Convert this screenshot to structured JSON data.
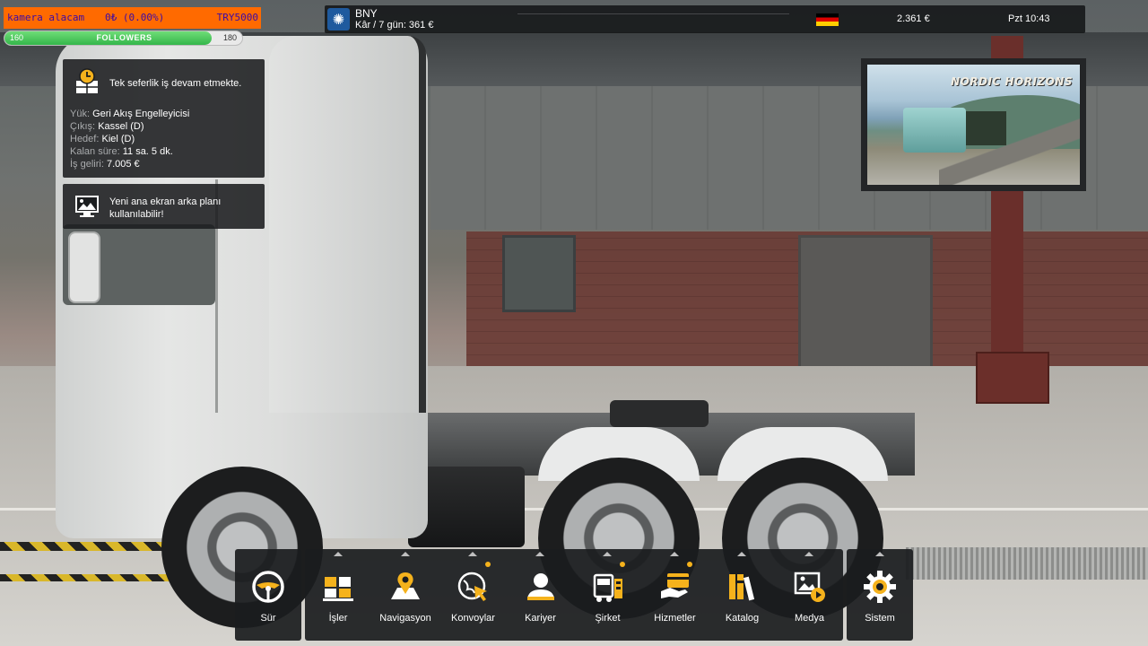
{
  "stream_overlay": {
    "title": "kamera alacam",
    "change": "0₺ (0.00%)",
    "goal": "TRY5000",
    "followers": {
      "start": "160",
      "label": "FOLLOWERS",
      "goal": "180",
      "progress_fraction": 0.87
    }
  },
  "topbar": {
    "company_name": "BNY",
    "company_profit": "Kâr / 7 gün: 361 €",
    "country_flag": "germany-flag",
    "money": "2.361 €",
    "clock": "Pzt 10:43"
  },
  "job_notification": {
    "title": "Tek seferlik iş devam etmekte.",
    "fields": [
      {
        "key": "Yük:",
        "value": "Geri Akış Engelleyicisi"
      },
      {
        "key": "Çıkış:",
        "value": "Kassel (D)"
      },
      {
        "key": "Hedef:",
        "value": "Kiel (D)"
      },
      {
        "key": "Kalan süre:",
        "value": "11 sa. 5 dk."
      },
      {
        "key": "İş geliri:",
        "value": "7.005 €"
      }
    ]
  },
  "background_notification": {
    "title": "Yeni ana ekran arka planı kullanılabilir!"
  },
  "featured_image": {
    "title": "NORDIC HORIZONS"
  },
  "menu": {
    "items": [
      {
        "label": "Sür",
        "icon": "steering-wheel-icon"
      },
      {
        "label": "İşler",
        "icon": "cargo-boxes-icon"
      },
      {
        "label": "Navigasyon",
        "icon": "map-pin-icon"
      },
      {
        "label": "Konvoylar",
        "icon": "convoy-globe-icon"
      },
      {
        "label": "Kariyer",
        "icon": "person-icon"
      },
      {
        "label": "Şirket",
        "icon": "company-truck-icon"
      },
      {
        "label": "Hizmetler",
        "icon": "services-card-icon"
      },
      {
        "label": "Katalog",
        "icon": "catalog-books-icon"
      },
      {
        "label": "Medya",
        "icon": "media-image-icon"
      },
      {
        "label": "Sistem",
        "icon": "gear-icon"
      }
    ]
  },
  "colors": {
    "accent": "#f5b21c",
    "overlay_orange": "#ff6a00",
    "overlay_text": "#3a0aa8",
    "panel": "#1b1d1f"
  }
}
